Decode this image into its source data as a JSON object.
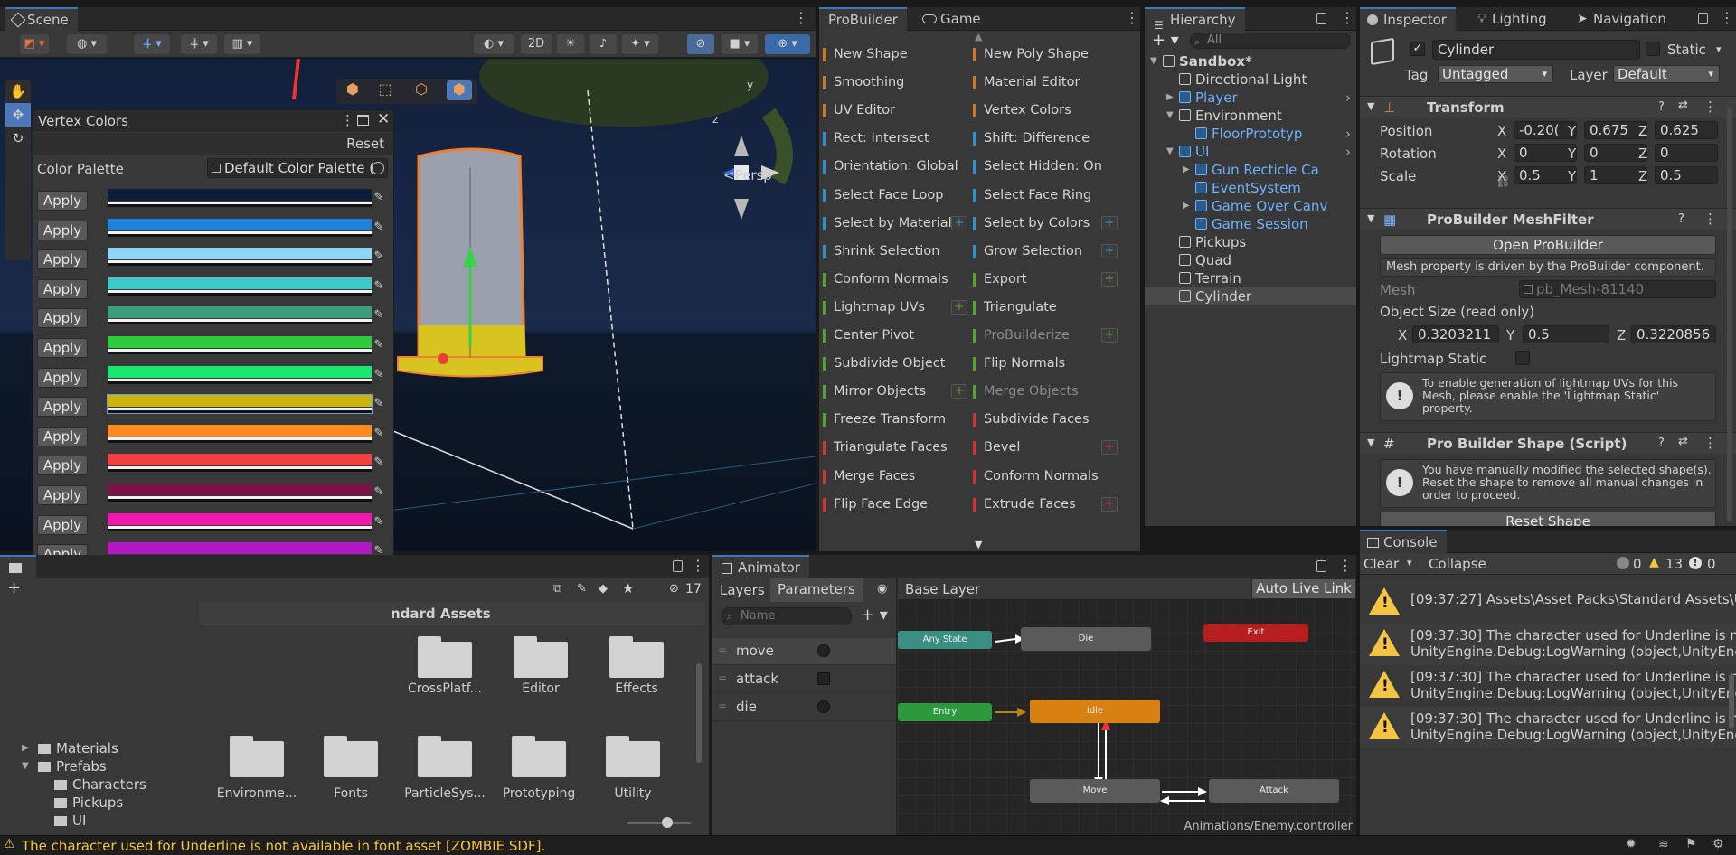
{
  "scene": {
    "tab_label": "Scene",
    "toolbar_2d": "2D",
    "persp_label": "Persp",
    "gizmo_y": "y",
    "gizmo_z": "z"
  },
  "vertex_colors": {
    "title": "Vertex Colors",
    "reset_label": "Reset",
    "palette_label": "Color Palette",
    "palette_value": "Default Color Palette (",
    "apply_label": "Apply",
    "swatches": [
      "#0d1e3a",
      "#1e82dc",
      "#8fd6f5",
      "#3ec9c9",
      "#3a9e7a",
      "#2ecb3d",
      "#18e870",
      "#ccb40e",
      "#ff8a1e",
      "#f04040",
      "#7a1245",
      "#ee18aa",
      "#b218c4",
      "#0a0a0a",
      "#a0a0a0",
      "#e8e8e8"
    ]
  },
  "probuilder": {
    "tab_label": "ProBuilder",
    "game_tab_label": "Game",
    "left_items": [
      {
        "label": "New Shape",
        "color": "#c27a3a"
      },
      {
        "label": "Smoothing",
        "color": "#c27a3a"
      },
      {
        "label": "UV Editor",
        "color": "#c27a3a"
      },
      {
        "label": "Rect: Intersect",
        "color": "#3a8fc2"
      },
      {
        "label": "Orientation: Global",
        "color": "#3a8fc2"
      },
      {
        "label": "Select Face Loop",
        "color": "#3a8fc2"
      },
      {
        "label": "Select by Material",
        "color": "#3a8fc2",
        "plus": true
      },
      {
        "label": "Shrink Selection",
        "color": "#3a8fc2"
      },
      {
        "label": "Conform Normals",
        "color": "#58a03a"
      },
      {
        "label": "Lightmap UVs",
        "color": "#58a03a",
        "plus": true
      },
      {
        "label": "Center Pivot",
        "color": "#58a03a"
      },
      {
        "label": "Subdivide Object",
        "color": "#58a03a"
      },
      {
        "label": "Mirror Objects",
        "color": "#58a03a",
        "plus": true
      },
      {
        "label": "Freeze Transform",
        "color": "#58a03a"
      },
      {
        "label": "Triangulate Faces",
        "color": "#c23a3a"
      },
      {
        "label": "Merge Faces",
        "color": "#c23a3a"
      },
      {
        "label": "Flip Face Edge",
        "color": "#c23a3a"
      }
    ],
    "right_items": [
      {
        "label": "New Poly Shape",
        "color": "#c27a3a"
      },
      {
        "label": "Material Editor",
        "color": "#c27a3a"
      },
      {
        "label": "Vertex Colors",
        "color": "#c27a3a"
      },
      {
        "label": "Shift: Difference",
        "color": "#3a8fc2"
      },
      {
        "label": "Select Hidden: On",
        "color": "#3a8fc2"
      },
      {
        "label": "Select Face Ring",
        "color": "#3a8fc2"
      },
      {
        "label": "Select by Colors",
        "color": "#3a8fc2",
        "plus": true
      },
      {
        "label": "Grow Selection",
        "color": "#3a8fc2",
        "plus": true
      },
      {
        "label": "Export",
        "color": "#58a03a",
        "plus": true
      },
      {
        "label": "Triangulate",
        "color": "#58a03a"
      },
      {
        "label": "ProBuilderize",
        "color": "#58a03a",
        "plus": true,
        "dim": true
      },
      {
        "label": "Flip Normals",
        "color": "#58a03a"
      },
      {
        "label": "Merge Objects",
        "color": "#58a03a",
        "dim": true
      },
      {
        "label": "Subdivide Faces",
        "color": "#c23a3a"
      },
      {
        "label": "Bevel",
        "color": "#c23a3a",
        "plus": true
      },
      {
        "label": "Conform Normals",
        "color": "#c23a3a"
      },
      {
        "label": "Extrude Faces",
        "color": "#c23a3a",
        "plus": true
      }
    ]
  },
  "hierarchy": {
    "tab_label": "Hierarchy",
    "search_placeholder": "All",
    "items": [
      {
        "label": "Sandbox*",
        "level": 0,
        "bold": true,
        "arrow": "down"
      },
      {
        "label": "Directional Light",
        "level": 1
      },
      {
        "label": "Player",
        "level": 1,
        "blue": true,
        "arrow": "right",
        "chev": true
      },
      {
        "label": "Environment",
        "level": 1,
        "arrow": "down"
      },
      {
        "label": "FloorPrototyp",
        "level": 2,
        "blue": true,
        "chev": true
      },
      {
        "label": "UI",
        "level": 1,
        "blue": true,
        "arrow": "down",
        "chev": true
      },
      {
        "label": "Gun Recticle Ca",
        "level": 2,
        "blue": true,
        "arrow": "right"
      },
      {
        "label": "EventSystem",
        "level": 2,
        "blue": true
      },
      {
        "label": "Game Over Canv",
        "level": 2,
        "blue": true,
        "arrow": "right"
      },
      {
        "label": "Game Session",
        "level": 2,
        "blue": true
      },
      {
        "label": "Pickups",
        "level": 1
      },
      {
        "label": "Quad",
        "level": 1
      },
      {
        "label": "Terrain",
        "level": 1
      },
      {
        "label": "Cylinder",
        "level": 1,
        "selected": true
      }
    ]
  },
  "inspector": {
    "tab_label": "Inspector",
    "lighting_tab": "Lighting",
    "navigation_tab": "Navigation",
    "object_name": "Cylinder",
    "static_label": "Static",
    "tag_label": "Tag",
    "tag_value": "Untagged",
    "layer_label": "Layer",
    "layer_value": "Default",
    "transform_title": "Transform",
    "position_label": "Position",
    "rotation_label": "Rotation",
    "scale_label": "Scale",
    "position": {
      "x": "-0.20(",
      "y": "0.675",
      "z": "0.625"
    },
    "rotation": {
      "x": "0",
      "y": "0",
      "z": "0"
    },
    "scale": {
      "x": "0.5",
      "y": "1",
      "z": "0.5"
    },
    "meshfilter_title": "ProBuilder MeshFilter",
    "open_probuilder": "Open ProBuilder",
    "mesh_driven_note": "Mesh property is driven by the ProBuilder component.",
    "mesh_label": "Mesh",
    "mesh_value": "pb_Mesh-81140",
    "object_size_label": "Object Size (read only)",
    "object_size": {
      "x": "0.3203211",
      "y": "0.5",
      "z": "0.3220856"
    },
    "lightmap_static_label": "Lightmap Static",
    "lightmap_help": "To enable generation of lightmap UVs for this Mesh, please enable the 'Lightmap Static' property.",
    "shape_title": "Pro Builder Shape (Script)",
    "shape_help": "You have manually modified the selected shape(s). Reset the shape to remove all manual changes in order to proceed.",
    "reset_shape": "Reset Shape"
  },
  "project": {
    "breadcrumb": "ndard Assets",
    "hidden_count": "17",
    "folders_row1": [
      "CrossPlatf...",
      "Editor",
      "Effects"
    ],
    "folders_row2": [
      "Environme...",
      "Fonts",
      "ParticleSys...",
      "Prototyping",
      "Utility"
    ],
    "tree": [
      {
        "label": "Materials",
        "level": 1
      },
      {
        "label": "Prefabs",
        "level": 1,
        "open": true
      },
      {
        "label": "Characters",
        "level": 2
      },
      {
        "label": "Pickups",
        "level": 2
      },
      {
        "label": "UI",
        "level": 2
      }
    ]
  },
  "animator": {
    "tab_label": "Animator",
    "layers_tab": "Layers",
    "parameters_tab": "Parameters",
    "base_layer": "Base Layer",
    "auto_live_link": "Auto Live Link",
    "search_placeholder": "Name",
    "params": [
      {
        "name": "move",
        "type": "bool"
      },
      {
        "name": "attack",
        "type": "trigger"
      },
      {
        "name": "die",
        "type": "bool"
      }
    ],
    "nodes": {
      "any": "Any State",
      "die": "Die",
      "exit": "Exit",
      "entry": "Entry",
      "idle": "Idle",
      "move": "Move",
      "attack": "Attack"
    },
    "controller_path": "Animations/Enemy.controller"
  },
  "console": {
    "tab_label": "Console",
    "clear_label": "Clear",
    "collapse_label": "Collapse",
    "info_count": "0",
    "warn_count": "13",
    "error_count": "0",
    "entries": [
      {
        "l1": "[09:37:27] Assets\\Asset Packs\\Standard Assets\\U",
        "l2": ""
      },
      {
        "l1": "[09:37:30] The character used for Underline is nc",
        "l2": "UnityEngine.Debug:LogWarning (object,UnityEng"
      },
      {
        "l1": "[09:37:30] The character used for Underline is nc",
        "l2": "UnityEngine.Debug:LogWarning (object,UnityEng"
      },
      {
        "l1": "[09:37:30] The character used for Underline is nc",
        "l2": "UnityEngine.Debug:LogWarning (object,UnityEng"
      }
    ]
  },
  "status_bar": {
    "message": "The character used for Underline is not available in font asset [ZOMBIE SDF]."
  }
}
